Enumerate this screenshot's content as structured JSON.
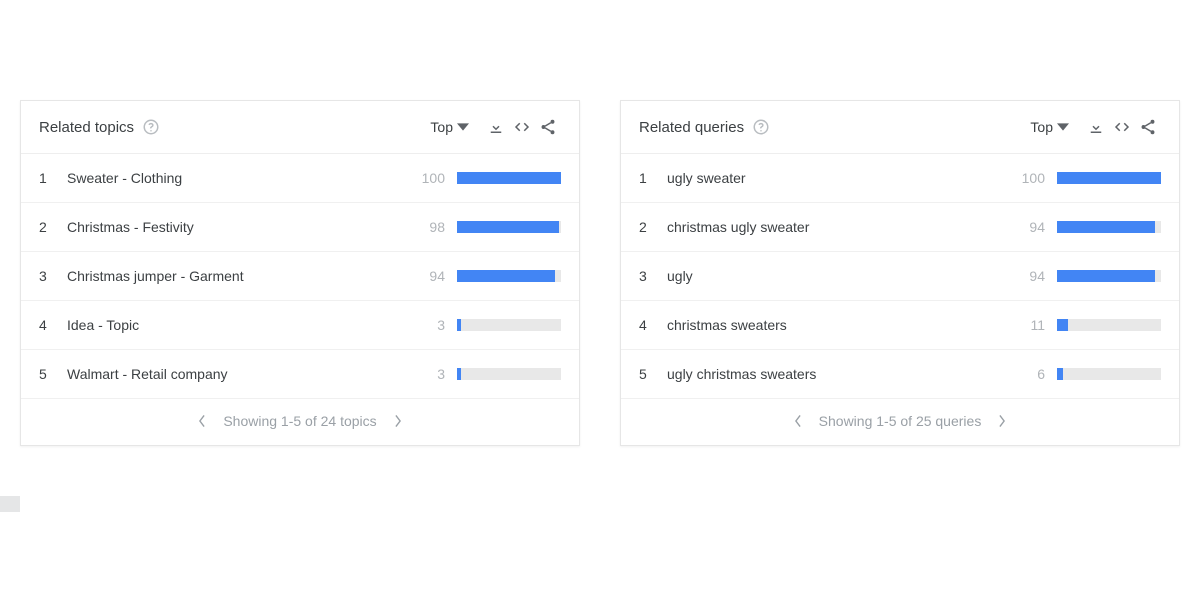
{
  "panels": [
    {
      "title": "Related topics",
      "sort_label": "Top",
      "items": [
        {
          "rank": "1",
          "label": "Sweater - Clothing",
          "value": 100
        },
        {
          "rank": "2",
          "label": "Christmas - Festivity",
          "value": 98
        },
        {
          "rank": "3",
          "label": "Christmas jumper - Garment",
          "value": 94
        },
        {
          "rank": "4",
          "label": "Idea - Topic",
          "value": 3
        },
        {
          "rank": "5",
          "label": "Walmart - Retail company",
          "value": 3
        }
      ],
      "footer_text": "Showing 1-5 of 24 topics"
    },
    {
      "title": "Related queries",
      "sort_label": "Top",
      "items": [
        {
          "rank": "1",
          "label": "ugly sweater",
          "value": 100
        },
        {
          "rank": "2",
          "label": "christmas ugly sweater",
          "value": 94
        },
        {
          "rank": "3",
          "label": "ugly",
          "value": 94
        },
        {
          "rank": "4",
          "label": "christmas sweaters",
          "value": 11
        },
        {
          "rank": "5",
          "label": "ugly christmas sweaters",
          "value": 6
        }
      ],
      "footer_text": "Showing 1-5 of 25 queries"
    }
  ]
}
